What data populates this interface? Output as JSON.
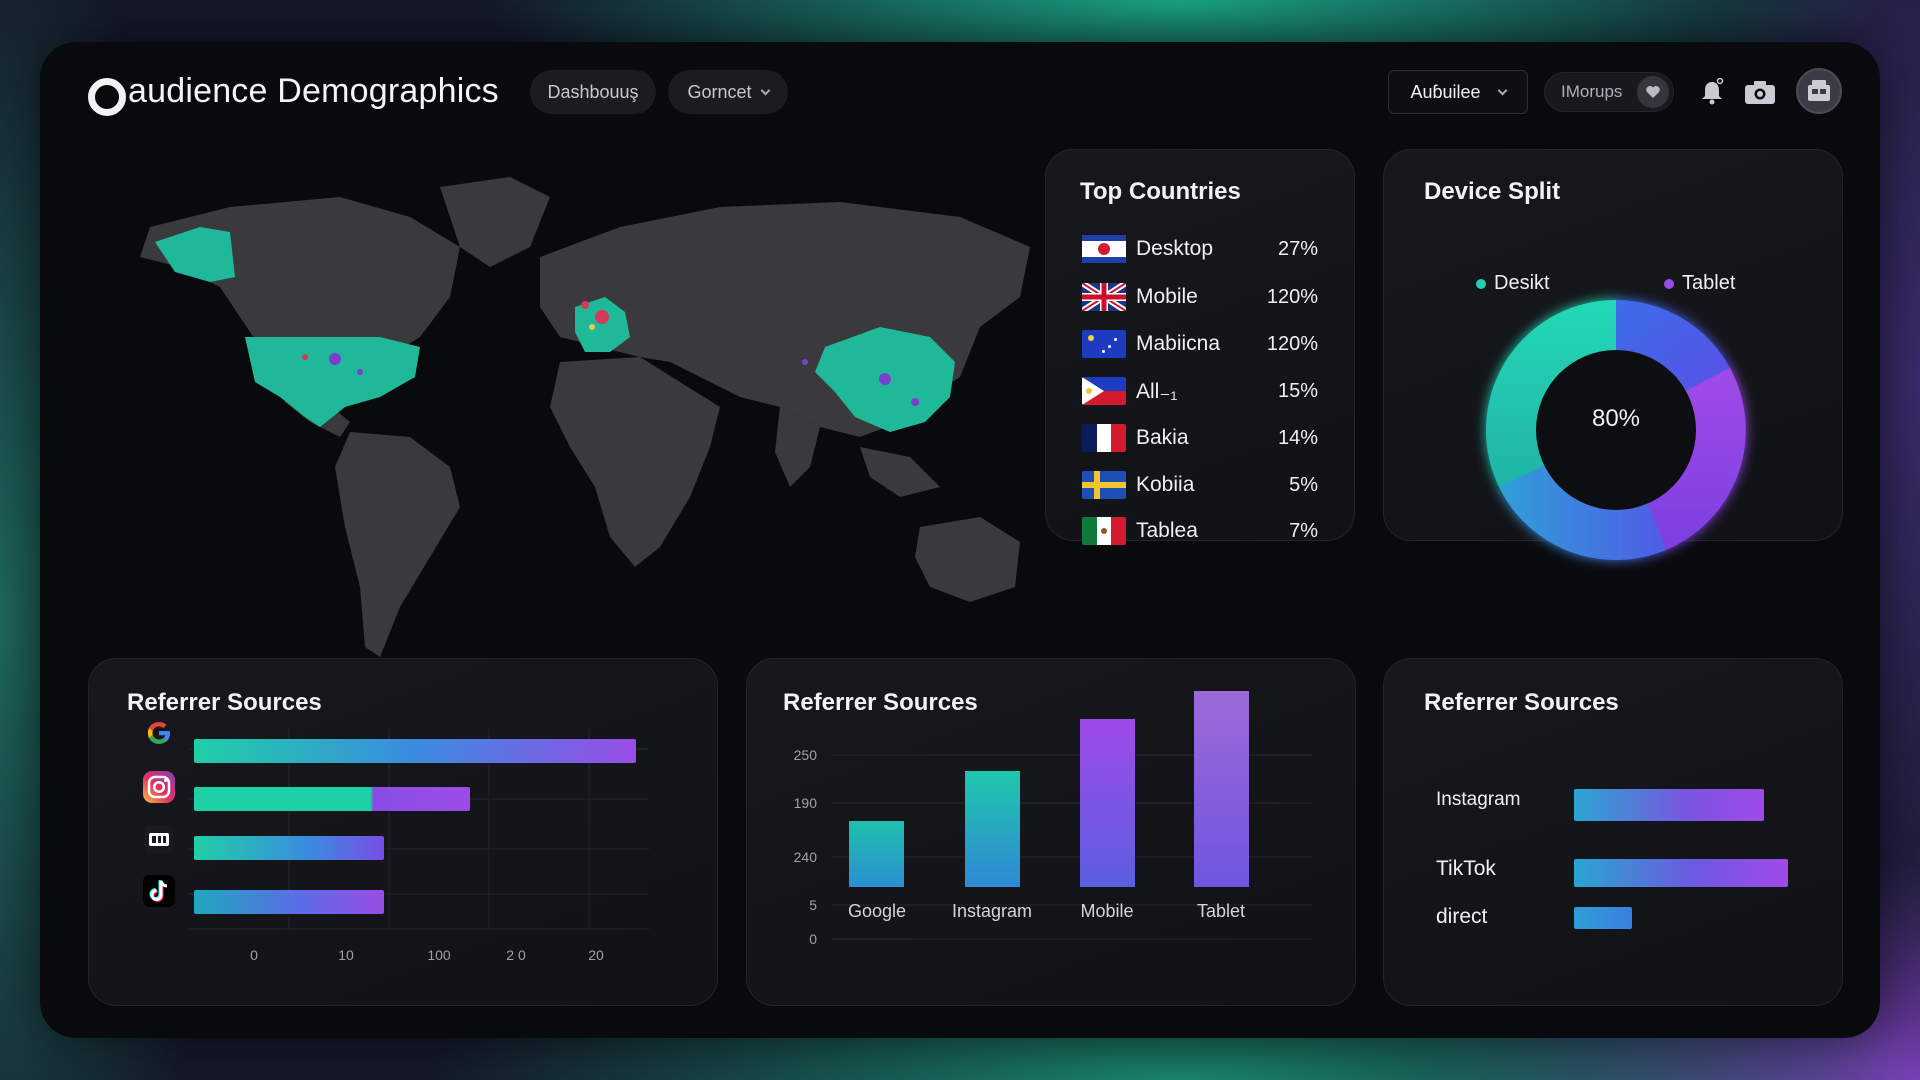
{
  "header": {
    "title": "audience Demographics",
    "nav_pill_1": "Dashbouuş",
    "nav_pill_2": "Gorncet",
    "select_label": "Auɓuilee",
    "search_label": "IMorups"
  },
  "icons": {
    "logo": "logo-ring-icon",
    "bell": "bell-icon",
    "camera": "camera-icon",
    "avatar": "avatar-icon",
    "heart": "heart-icon"
  },
  "colors": {
    "teal": "#1fd1b0",
    "purple": "#9a4de6",
    "blue": "#3c7fe0",
    "card_bg": "#15161b",
    "map_land": "#3a3a3d",
    "map_highlight": "#1fb99a"
  },
  "world_map": {
    "highlighted_regions": [
      "North America",
      "Western Europe",
      "China"
    ]
  },
  "top_countries": {
    "title": "Top Countries",
    "rows": [
      {
        "name": "Desktop",
        "pct": "27%",
        "flag": "japan-stripe"
      },
      {
        "name": "Mobile",
        "pct": "120%",
        "flag": "uk"
      },
      {
        "name": "Mabiicna",
        "pct": "120%",
        "flag": "blue-stars"
      },
      {
        "name": "All₋₁",
        "pct": "15%",
        "flag": "philippines"
      },
      {
        "name": "Bakia",
        "pct": "14%",
        "flag": "france"
      },
      {
        "name": "Kobiia",
        "pct": "5%",
        "flag": "sweden"
      },
      {
        "name": "Tablea",
        "pct": "7%",
        "flag": "mexico"
      }
    ]
  },
  "device_split": {
    "title": "Device Split",
    "legend": [
      {
        "label": "Desikt",
        "color": "#1fd1b0"
      },
      {
        "label": "Tablet",
        "color": "#9a4de6"
      }
    ],
    "center_label": "80%"
  },
  "referrer_1": {
    "title": "Referrer Sources",
    "sources": [
      {
        "icon": "google-icon",
        "value": 1.0
      },
      {
        "icon": "instagram-icon",
        "value": 0.62
      },
      {
        "icon": "browser-icon",
        "value": 0.43
      },
      {
        "icon": "tiktok-icon",
        "value": 0.43
      }
    ],
    "x_ticks": [
      "0",
      "10",
      "100",
      "2 0",
      "20"
    ]
  },
  "referrer_2": {
    "title": "Referrer Sources",
    "y_ticks": [
      "250",
      "190",
      "240",
      "5",
      "0"
    ],
    "categories": [
      "Google",
      "Instagram",
      "Mobile",
      "Tablet"
    ],
    "values": [
      0.33,
      0.59,
      0.86,
      1.0
    ]
  },
  "referrer_3": {
    "title": "Referrer Sources",
    "rows": [
      {
        "label": "Instagram",
        "value": 0.89
      },
      {
        "label": "TikTok",
        "value": 1.0
      },
      {
        "label": "direct",
        "value": 0.27
      }
    ]
  },
  "chart_data": [
    {
      "type": "bar",
      "title": "Referrer Sources",
      "orientation": "horizontal",
      "categories": [
        "google",
        "instagram",
        "browser",
        "tiktok"
      ],
      "values": [
        1.0,
        0.62,
        0.43,
        0.43
      ],
      "x_tick_labels": [
        "0",
        "10",
        "100",
        "2 0",
        "20"
      ],
      "grid": true
    },
    {
      "type": "bar",
      "title": "Referrer Sources",
      "categories": [
        "Google",
        "Instagram",
        "Mobile",
        "Tablet"
      ],
      "values": [
        0.33,
        0.59,
        0.86,
        1.0
      ],
      "y_tick_labels": [
        "250",
        "190",
        "240",
        "5",
        "0"
      ],
      "grid": true
    },
    {
      "type": "bar",
      "title": "Referrer Sources",
      "orientation": "horizontal",
      "categories": [
        "Instagram",
        "TikTok",
        "direct"
      ],
      "values": [
        0.89,
        1.0,
        0.27
      ]
    },
    {
      "type": "pie",
      "title": "Device Split",
      "center_label": "80%",
      "legend": [
        "Desikt",
        "Tablet"
      ],
      "legend_placement": "top"
    }
  ]
}
